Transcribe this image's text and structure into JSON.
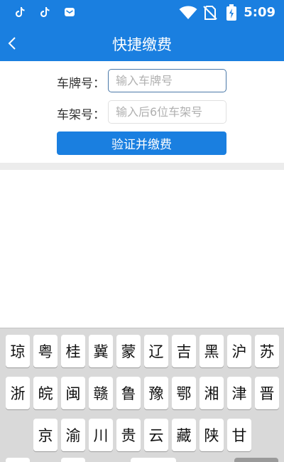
{
  "status_bar": {
    "time": "5:09",
    "left_icons": [
      "tiktok-icon",
      "tiktok-icon",
      "mail-app-icon"
    ],
    "right_icons": [
      "wifi-icon",
      "no-sim-icon",
      "battery-icon"
    ]
  },
  "header": {
    "title": "快捷缴费",
    "back_icon": "chevron-left-icon",
    "color": "#1a7fe0"
  },
  "form": {
    "plate": {
      "label": "车牌号：",
      "placeholder": "输入车牌号",
      "value": ""
    },
    "vin": {
      "label": "车架号：",
      "placeholder": "输入后6位车架号",
      "value": ""
    },
    "submit_label": "验证并缴费"
  },
  "keyboard": {
    "rows": [
      [
        "琼",
        "粤",
        "桂",
        "冀",
        "蒙",
        "辽",
        "吉",
        "黑",
        "沪",
        "苏"
      ],
      [
        "浙",
        "皖",
        "闽",
        "赣",
        "鲁",
        "豫",
        "鄂",
        "湘",
        "津",
        "晋"
      ],
      [
        "京",
        "渝",
        "川",
        "贵",
        "云",
        "藏",
        "陕",
        "甘"
      ]
    ]
  }
}
